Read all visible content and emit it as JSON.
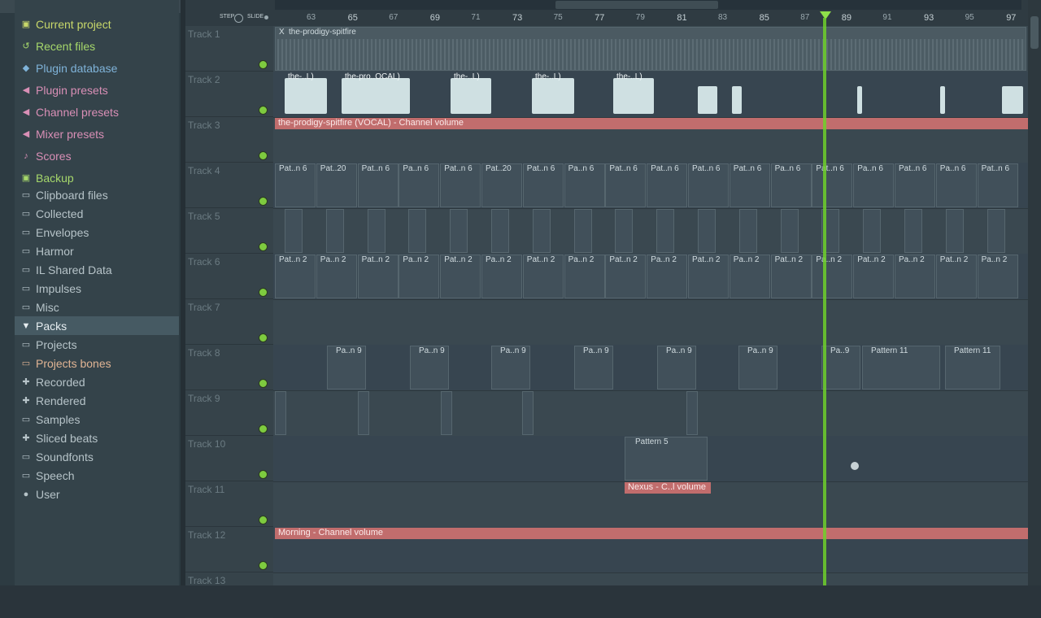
{
  "browser": {
    "items": [
      {
        "label": "Current project",
        "icon": "project-icon",
        "color": "#c8d86a"
      },
      {
        "label": "Recent files",
        "icon": "recent-icon",
        "color": "#a6d86b"
      },
      {
        "label": "Plugin database",
        "icon": "plug-icon",
        "color": "#7fb3d9"
      },
      {
        "label": "Plugin presets",
        "icon": "plug-preset-icon",
        "color": "#d98fb6"
      },
      {
        "label": "Channel presets",
        "icon": "channel-preset-icon",
        "color": "#d98fb6"
      },
      {
        "label": "Mixer presets",
        "icon": "mixer-preset-icon",
        "color": "#d98fb6"
      },
      {
        "label": "Scores",
        "icon": "note-icon",
        "color": "#d98fb6"
      },
      {
        "label": "Backup",
        "icon": "backup-icon",
        "color": "#a6d86b"
      },
      {
        "label": "Clipboard files",
        "icon": "folder-icon",
        "color": "#b6c3c8"
      },
      {
        "label": "Collected",
        "icon": "folder-icon",
        "color": "#b6c3c8"
      },
      {
        "label": "Envelopes",
        "icon": "folder-icon",
        "color": "#b6c3c8"
      },
      {
        "label": "Harmor",
        "icon": "folder-icon",
        "color": "#b6c3c8"
      },
      {
        "label": "IL Shared Data",
        "icon": "folder-icon",
        "color": "#b6c3c8"
      },
      {
        "label": "Impulses",
        "icon": "folder-icon",
        "color": "#b6c3c8"
      },
      {
        "label": "Misc",
        "icon": "folder-icon",
        "color": "#b6c3c8"
      },
      {
        "label": "Packs",
        "icon": "packs-icon",
        "color": "#e7eef1"
      },
      {
        "label": "Projects",
        "icon": "folder-icon",
        "color": "#b6c3c8"
      },
      {
        "label": "Projects bones",
        "icon": "folder-icon",
        "color": "#e0b494"
      },
      {
        "label": "Recorded",
        "icon": "recorded-icon",
        "color": "#b6c3c8"
      },
      {
        "label": "Rendered",
        "icon": "rendered-icon",
        "color": "#b6c3c8"
      },
      {
        "label": "Samples",
        "icon": "folder-icon",
        "color": "#b6c3c8"
      },
      {
        "label": "Sliced beats",
        "icon": "sliced-icon",
        "color": "#b6c3c8"
      },
      {
        "label": "Soundfonts",
        "icon": "folder-icon",
        "color": "#b6c3c8"
      },
      {
        "label": "Speech",
        "icon": "folder-icon",
        "color": "#b6c3c8"
      },
      {
        "label": "User",
        "icon": "user-icon",
        "color": "#b6c3c8"
      }
    ],
    "selected": "Packs"
  },
  "ruler": {
    "step_label": "STEP",
    "slide_label": "SLIDE",
    "bars_odd": [
      "63",
      "65",
      "67",
      "69",
      "71",
      "73",
      "75",
      "77",
      "79",
      "81",
      "83",
      "85",
      "87",
      "89",
      "91",
      "93",
      "95",
      "97"
    ]
  },
  "tracks": [
    "Track 1",
    "Track 2",
    "Track 3",
    "Track 4",
    "Track 5",
    "Track 6",
    "Track 7",
    "Track 8",
    "Track 9",
    "Track 10",
    "Track 11",
    "Track 12",
    "Track 13"
  ],
  "clips": {
    "t1_title": "the-prodigy-spitfire",
    "t1_close": "X",
    "t2_labels": [
      "the-..L)",
      "the-pro..OCAL)",
      "the-..L)",
      "the-..L)",
      "the-..L)"
    ],
    "t3_auto": "the-prodigy-spitfire (VOCAL) - Channel volume",
    "t4_labels": [
      "Pat..n 6",
      "Pat..20",
      "Pat..n 6",
      "Pa..n 6",
      "Pat..n 6",
      "Pat..20",
      "Pat..n 6",
      "Pa..n 6",
      "Pat..n 6",
      "Pat..n 6",
      "Pat..n 6",
      "Pat..n 6",
      "Pa..n 6",
      "Pat..n 6",
      "Pa..n 6",
      "Pat..n 6",
      "Pa..n 6",
      "Pat..n 6"
    ],
    "t6_labels": [
      "Pat..n 2",
      "Pa..n 2",
      "Pat..n 2",
      "Pa..n 2",
      "Pat..n 2",
      "Pa..n 2",
      "Pat..n 2",
      "Pa..n 2",
      "Pat..n 2",
      "Pa..n 2",
      "Pat..n 2",
      "Pa..n 2",
      "Pat..n 2",
      "Pa..n 2",
      "Pat..n 2",
      "Pa..n 2",
      "Pat..n 2",
      "Pa..n 2"
    ],
    "t8_labels": [
      "Pa..n 9",
      "Pa..n 9",
      "Pa..n 9",
      "Pa..n 9",
      "Pa..n 9",
      "Pa..n 9",
      "Pa..9",
      "Pattern 11",
      "Pattern 11"
    ],
    "t10_label": "Pattern 5",
    "t11_label": "Nexus - C..l volume",
    "t12_auto": "Morning - Channel volume"
  },
  "colors": {
    "playhead": "#6fd02a",
    "automation": "#c16d6d",
    "vocal_clip": "#cfe0e2",
    "track_led": "#7ecb3f"
  }
}
